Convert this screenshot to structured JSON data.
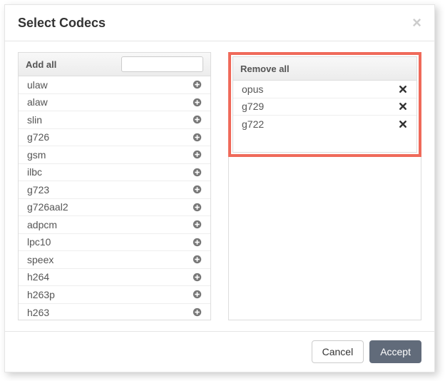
{
  "modal": {
    "title": "Select Codecs",
    "close_glyph": "×"
  },
  "left_panel": {
    "header_label": "Add all",
    "filter_value": "",
    "filter_placeholder": "",
    "items": [
      {
        "name": "ulaw"
      },
      {
        "name": "alaw"
      },
      {
        "name": "slin"
      },
      {
        "name": "g726"
      },
      {
        "name": "gsm"
      },
      {
        "name": "ilbc"
      },
      {
        "name": "g723"
      },
      {
        "name": "g726aal2"
      },
      {
        "name": "adpcm"
      },
      {
        "name": "lpc10"
      },
      {
        "name": "speex"
      },
      {
        "name": "h264"
      },
      {
        "name": "h263p"
      },
      {
        "name": "h263"
      }
    ]
  },
  "right_panel": {
    "header_label": "Remove all",
    "items": [
      {
        "name": "opus"
      },
      {
        "name": "g729"
      },
      {
        "name": "g722"
      }
    ]
  },
  "footer": {
    "cancel_label": "Cancel",
    "accept_label": "Accept"
  },
  "colors": {
    "highlight_border": "#ef6a5a",
    "primary_button": "#616b7a"
  }
}
